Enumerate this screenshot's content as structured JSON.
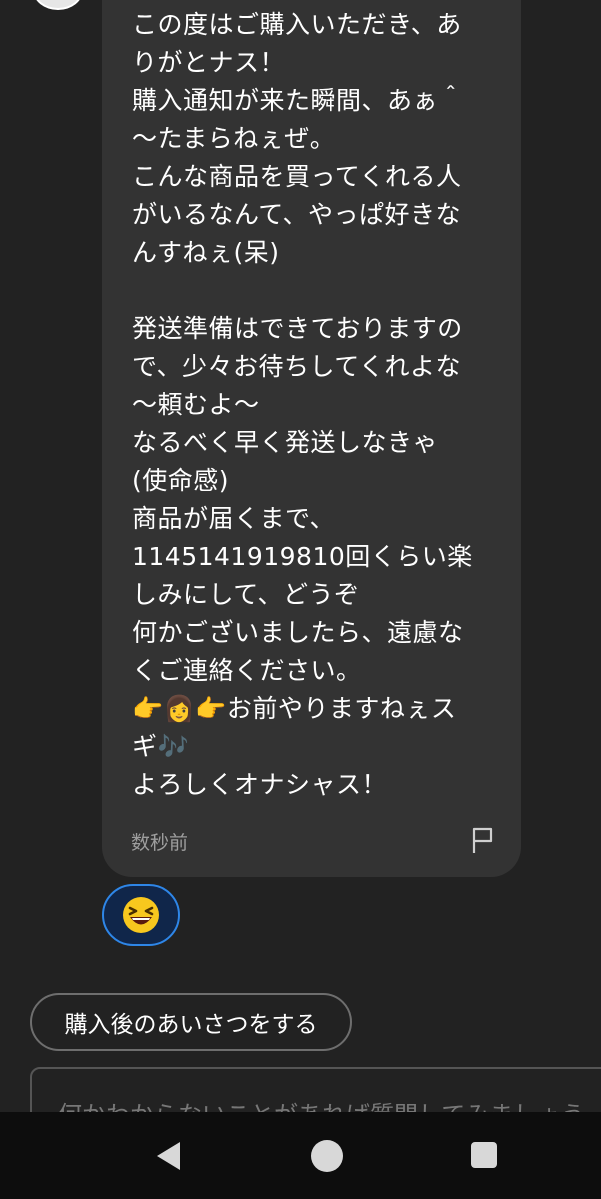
{
  "message": {
    "lines": [
      "この度はご購入いただき、あ",
      "りがとナス！",
      "購入通知が来た瞬間、あぁ＾",
      "〜たまらねぇぜ。",
      "こんな商品を買ってくれる人",
      "がいるなんて、やっぱ好きな",
      "んすねぇ(呆)",
      "",
      "発送準備はできておりますの",
      "で、少々お待ちしてくれよな",
      "〜頼むよ〜",
      "なるべく早く発送しなきゃ",
      "(使命感)",
      "商品が届くまで、",
      "1145141919810回くらい楽",
      "しみにして、どうぞ",
      "何かございましたら、遠慮な",
      "くご連絡ください。",
      "👉👩👉お前やりますねぇス",
      "ギ🎶",
      "よろしくオナシャス！"
    ],
    "timestamp": "数秒前"
  },
  "reaction": {
    "emoji": "😆"
  },
  "greeting_button": {
    "label": "購入後のあいさつをする"
  },
  "composer": {
    "placeholder": "何かわからないことがあれば質問してみましょう"
  },
  "colors": {
    "accent": "#2e86e8",
    "bubble": "#333333",
    "background": "#222222"
  },
  "navbar": {
    "icons": [
      "back-icon",
      "home-icon",
      "recents-icon"
    ]
  }
}
